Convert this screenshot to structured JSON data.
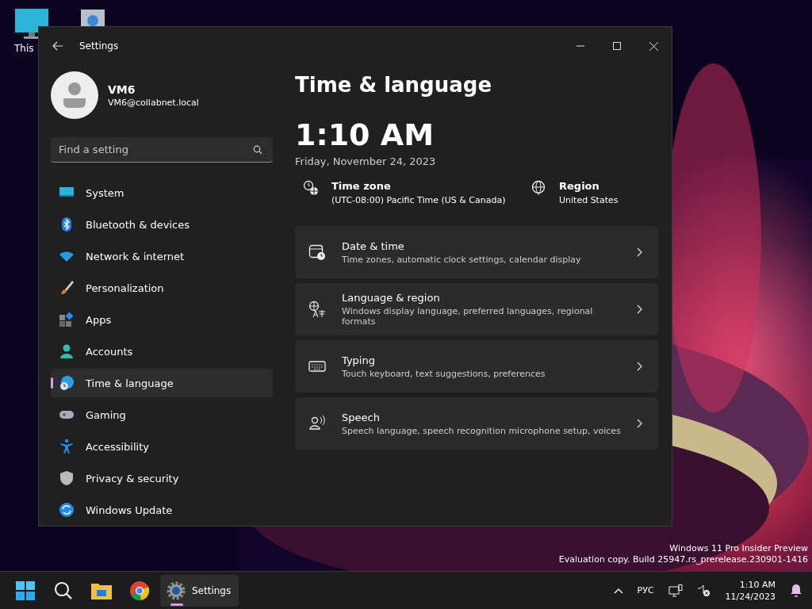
{
  "desktop": {
    "icons": [
      {
        "label": "This"
      }
    ]
  },
  "window": {
    "title": "Settings"
  },
  "profile": {
    "name": "VM6",
    "email": "VM6@collabnet.local"
  },
  "search": {
    "placeholder": "Find a setting"
  },
  "sidebar": {
    "items": [
      {
        "label": "System",
        "selected": false
      },
      {
        "label": "Bluetooth & devices",
        "selected": false
      },
      {
        "label": "Network & internet",
        "selected": false
      },
      {
        "label": "Personalization",
        "selected": false
      },
      {
        "label": "Apps",
        "selected": false
      },
      {
        "label": "Accounts",
        "selected": false
      },
      {
        "label": "Time & language",
        "selected": true
      },
      {
        "label": "Gaming",
        "selected": false
      },
      {
        "label": "Accessibility",
        "selected": false
      },
      {
        "label": "Privacy & security",
        "selected": false
      },
      {
        "label": "Windows Update",
        "selected": false
      }
    ]
  },
  "page": {
    "title": "Time & language",
    "time": "1:10 AM",
    "date": "Friday, November 24, 2023",
    "info": [
      {
        "label": "Time zone",
        "value": "(UTC-08:00) Pacific Time (US & Canada)"
      },
      {
        "label": "Region",
        "value": "United States"
      }
    ],
    "cards": [
      {
        "title": "Date & time",
        "subtitle": "Time zones, automatic clock settings, calendar display"
      },
      {
        "title": "Language & region",
        "subtitle": "Windows display language, preferred languages, regional formats"
      },
      {
        "title": "Typing",
        "subtitle": "Touch keyboard, text suggestions, preferences"
      },
      {
        "title": "Speech",
        "subtitle": "Speech language, speech recognition microphone setup, voices"
      }
    ]
  },
  "watermark": [
    "Windows 11 Pro Insider Preview",
    "Evaluation copy. Build 25947.rs_prerelease.230901-1416"
  ],
  "taskbar": {
    "apps": [
      {
        "selected": false
      },
      {
        "selected": false
      },
      {
        "selected": false
      },
      {
        "selected": false
      },
      {
        "label": "Settings",
        "selected": true
      }
    ],
    "language": "РУС",
    "time": "1:10 AM",
    "date": "11/24/2023"
  }
}
